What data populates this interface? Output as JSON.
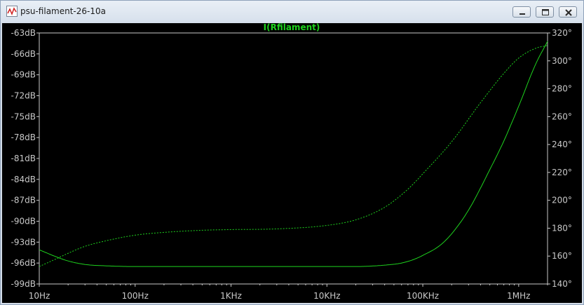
{
  "window": {
    "title": "psu-filament-26-10a",
    "buttons": {
      "minimize": "minimize-icon",
      "maximize": "maximize-icon",
      "close": "close-icon"
    }
  },
  "colors": {
    "trace": "#1ed21e",
    "axis_text": "#c8c8c8",
    "background": "#000000",
    "grid": "#3a3a3a"
  },
  "chart_data": {
    "type": "line",
    "title": "I(Rfilament)",
    "x_scale": "log",
    "xlim": [
      10,
      2000000
    ],
    "x_ticks": [
      {
        "value": 10,
        "label": "10Hz"
      },
      {
        "value": 100,
        "label": "100Hz"
      },
      {
        "value": 1000,
        "label": "1KHz"
      },
      {
        "value": 10000,
        "label": "10KHz"
      },
      {
        "value": 100000,
        "label": "100KHz"
      },
      {
        "value": 1000000,
        "label": "1MHz"
      }
    ],
    "y_left": {
      "unit": "dB",
      "ylim": [
        -99,
        -63
      ],
      "ticks": [
        "-63dB",
        "-66dB",
        "-69dB",
        "-72dB",
        "-75dB",
        "-78dB",
        "-81dB",
        "-84dB",
        "-87dB",
        "-90dB",
        "-93dB",
        "-96dB",
        "-99dB"
      ],
      "tick_values": [
        -63,
        -66,
        -69,
        -72,
        -75,
        -78,
        -81,
        -84,
        -87,
        -90,
        -93,
        -96,
        -99
      ]
    },
    "y_right": {
      "unit": "°",
      "ylim": [
        140,
        320
      ],
      "ticks": [
        "320°",
        "300°",
        "280°",
        "260°",
        "240°",
        "220°",
        "200°",
        "180°",
        "160°",
        "140°"
      ],
      "tick_values": [
        320,
        300,
        280,
        260,
        240,
        220,
        200,
        180,
        160,
        140
      ]
    },
    "grid": false,
    "series": [
      {
        "style": "solid",
        "axis": "left",
        "points": [
          [
            10,
            -94.1
          ],
          [
            15,
            -95.1
          ],
          [
            20,
            -95.7
          ],
          [
            30,
            -96.2
          ],
          [
            50,
            -96.4
          ],
          [
            100,
            -96.5
          ],
          [
            1000,
            -96.5
          ],
          [
            10000,
            -96.5
          ],
          [
            20000,
            -96.5
          ],
          [
            40000,
            -96.3
          ],
          [
            60000,
            -96.0
          ],
          [
            80000,
            -95.5
          ],
          [
            100000,
            -94.9
          ],
          [
            150000,
            -93.5
          ],
          [
            200000,
            -91.8
          ],
          [
            300000,
            -88.4
          ],
          [
            500000,
            -82.6
          ],
          [
            700000,
            -78.5
          ],
          [
            1000000,
            -73.5
          ],
          [
            1500000,
            -67.5
          ],
          [
            2000000,
            -64.2
          ]
        ]
      },
      {
        "style": "dashed",
        "axis": "right",
        "points": [
          [
            10,
            152.5
          ],
          [
            15,
            158
          ],
          [
            20,
            162
          ],
          [
            30,
            167
          ],
          [
            50,
            171
          ],
          [
            100,
            175
          ],
          [
            200,
            177
          ],
          [
            500,
            178.5
          ],
          [
            1000,
            179
          ],
          [
            3000,
            179.5
          ],
          [
            10000,
            182
          ],
          [
            20000,
            186
          ],
          [
            40000,
            195
          ],
          [
            70000,
            208
          ],
          [
            100000,
            219
          ],
          [
            200000,
            242
          ],
          [
            400000,
            270
          ],
          [
            700000,
            291
          ],
          [
            1000000,
            302
          ],
          [
            1500000,
            309
          ],
          [
            2000000,
            311
          ]
        ]
      }
    ]
  }
}
